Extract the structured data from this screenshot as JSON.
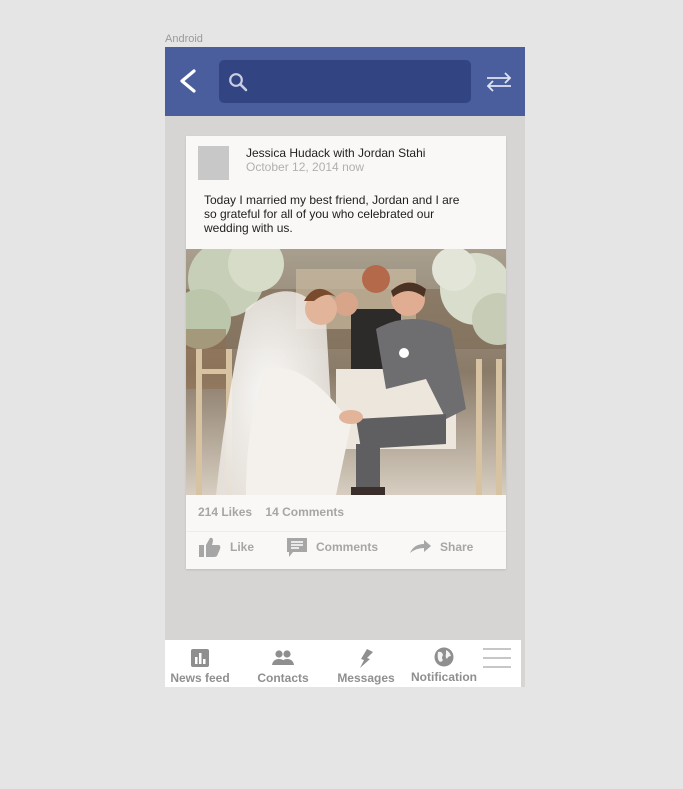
{
  "device_label": "Android",
  "colors": {
    "appbar": "#4a5e9e",
    "search_box": "#324482",
    "phone_background": "#d6d5d3",
    "card_background": "#faf8f6",
    "muted_text": "#a6a6a6"
  },
  "appbar": {
    "back_icon": "chevron-left-icon",
    "search": {
      "icon": "search-icon",
      "value": "",
      "placeholder": ""
    },
    "swap_icon": "swap-arrows-icon"
  },
  "post": {
    "author": "Jessica Hudack with Jordan Stahi",
    "timestamp": "October 12, 2014 now",
    "text": "Today I married my best friend, Jordan and I are so grateful for all of you who celebrated our wedding with us.",
    "photo": "wedding-photo",
    "stats": {
      "likes": "214 Likes",
      "comments": "14 Comments"
    },
    "actions": {
      "like": "Like",
      "comments": "Comments",
      "share": "Share"
    }
  },
  "bottom_nav": {
    "items": [
      {
        "label": "News feed",
        "icon": "bar-chart-icon"
      },
      {
        "label": "Contacts",
        "icon": "people-icon"
      },
      {
        "label": "Messages",
        "icon": "lightning-icon"
      },
      {
        "label": "Notification",
        "icon": "globe-icon"
      }
    ],
    "menu_icon": "hamburger-menu-icon"
  }
}
